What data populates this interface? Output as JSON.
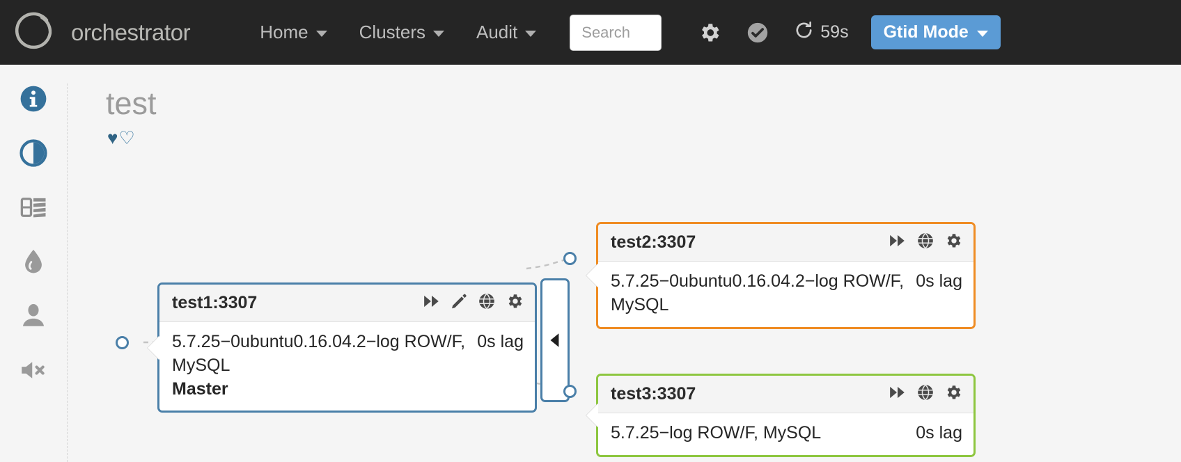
{
  "navbar": {
    "brand": "orchestrator",
    "links": [
      {
        "label": "Home"
      },
      {
        "label": "Clusters"
      },
      {
        "label": "Audit"
      }
    ],
    "search": {
      "value": "",
      "placeholder": "Search"
    },
    "icons": [
      {
        "name": "gear-icon"
      },
      {
        "name": "check-circle-icon"
      }
    ],
    "refresh": {
      "icon": "refresh-icon",
      "label": "59s"
    },
    "gtid_button": {
      "label": "Gtid Mode"
    }
  },
  "sidebar": {
    "items": [
      {
        "name": "info-icon",
        "label": "Info"
      },
      {
        "name": "adjust-contrast-icon",
        "label": "Compact display"
      },
      {
        "name": "server-list-icon",
        "label": "Instance details"
      },
      {
        "name": "tint-droplet-icon",
        "label": "Pool"
      },
      {
        "name": "user-icon",
        "label": "User"
      },
      {
        "name": "volume-mute-icon",
        "label": "Mute alerts"
      }
    ]
  },
  "cluster": {
    "title": "test",
    "hearts": {
      "filled": "♥",
      "outline": "♡"
    }
  },
  "topology": {
    "collapse_handle": {
      "icon": "chevron-left-icon"
    },
    "nodes": [
      {
        "id": "test1",
        "name": "test1:3307",
        "border_color": "#4a7fa8",
        "version": "5.7.25−0ubuntu0.16.04.2−log ROW/F,",
        "lag": "0s lag",
        "flavor": "MySQL",
        "role": "Master",
        "icons": [
          "forward-icon",
          "pencil-icon",
          "globe-icon",
          "gear-icon"
        ]
      },
      {
        "id": "test2",
        "name": "test2:3307",
        "border_color": "#ef8c23",
        "version": "5.7.25−0ubuntu0.16.04.2−log ROW/F,",
        "lag": "0s lag",
        "flavor": "MySQL",
        "role": "",
        "icons": [
          "forward-icon",
          "globe-icon",
          "gear-icon"
        ]
      },
      {
        "id": "test3",
        "name": "test3:3307",
        "border_color": "#8dc63f",
        "version": "5.7.25−log ROW/F, MySQL",
        "lag": "0s lag",
        "flavor": "",
        "role": "",
        "icons": [
          "forward-icon",
          "globe-icon",
          "gear-icon"
        ]
      }
    ]
  },
  "colors": {
    "navbar_bg": "#252525",
    "accent_blue": "#5b9bd5",
    "master_border": "#4a7fa8",
    "orange_border": "#ef8c23",
    "green_border": "#8dc63f",
    "page_bg": "#f5f5f5"
  }
}
